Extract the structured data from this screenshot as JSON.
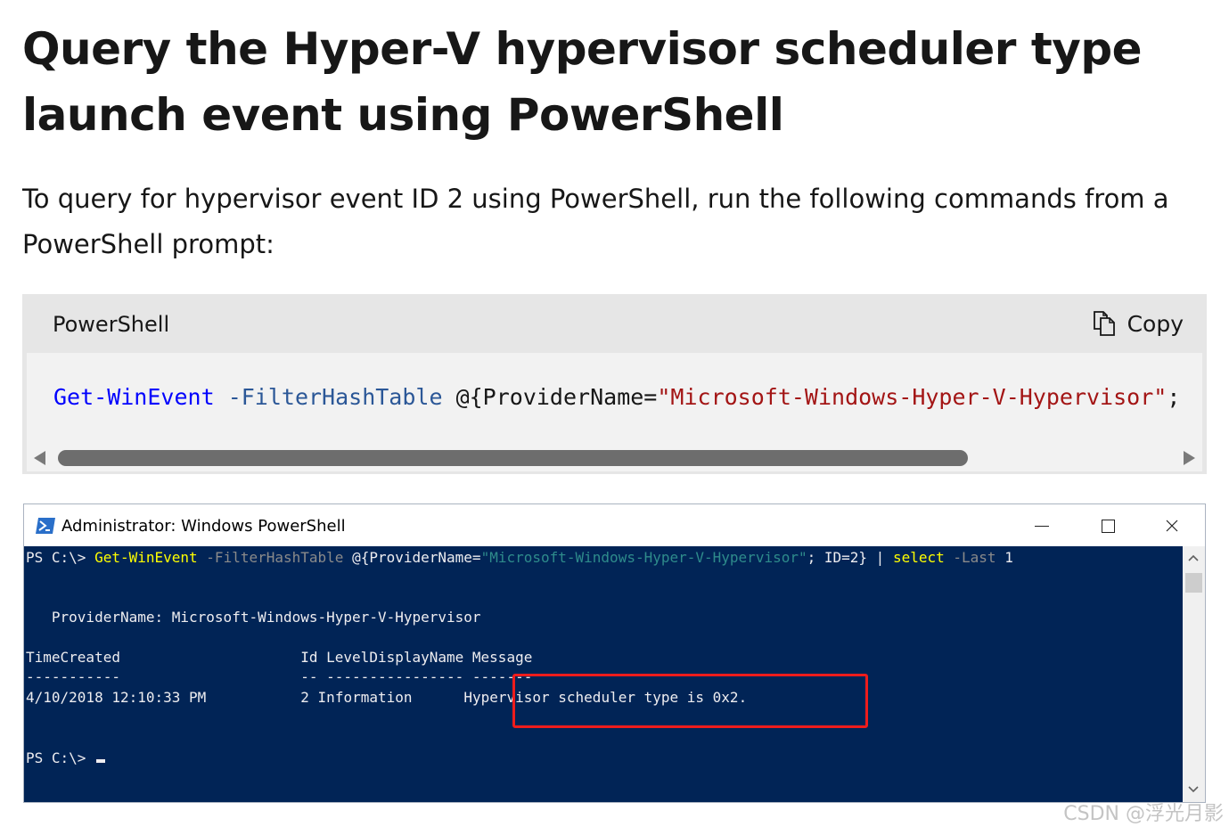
{
  "heading": {
    "title": "Query the Hyper-V hypervisor scheduler type launch event using PowerShell",
    "intro": "To query for hypervisor event ID 2 using PowerShell, run the following commands from a PowerShell prompt:"
  },
  "code_block": {
    "language": "PowerShell",
    "copy_label": "Copy",
    "tokens": {
      "cmd": "Get-WinEvent",
      "param": "-FilterHashTable",
      "open": "@{ProviderName=",
      "str": "\"Microsoft-Windows-Hyper-V-Hypervisor\"",
      "tail": ";"
    }
  },
  "ps_window": {
    "title": "Administrator: Windows PowerShell",
    "line1": {
      "prompt": "PS C:\\> ",
      "cmd": "Get-WinEvent",
      "param": "-FilterHashTable",
      "open": "@{ProviderName=",
      "str": "\"Microsoft-Windows-Hyper-V-Hypervisor\"",
      "mid": "; ID=2} | ",
      "cmd2": "select",
      "param2": "-Last",
      "arg": "1"
    },
    "provider_line": "   ProviderName: Microsoft-Windows-Hyper-V-Hypervisor",
    "table_header": "TimeCreated                     Id LevelDisplayName Message",
    "table_rule": "-----------                     -- ---------------- -------",
    "table_row": {
      "time": "4/10/2018 12:10:33 PM",
      "id": "2",
      "level": "Information",
      "message": "Hypervisor scheduler type is 0x2."
    },
    "final_prompt": "PS C:\\> "
  },
  "watermark": "CSDN @浮光月影",
  "colors": {
    "console_bg": "#012456",
    "highlight": "#ee1c1c",
    "code_bg": "#e6e6e6"
  }
}
